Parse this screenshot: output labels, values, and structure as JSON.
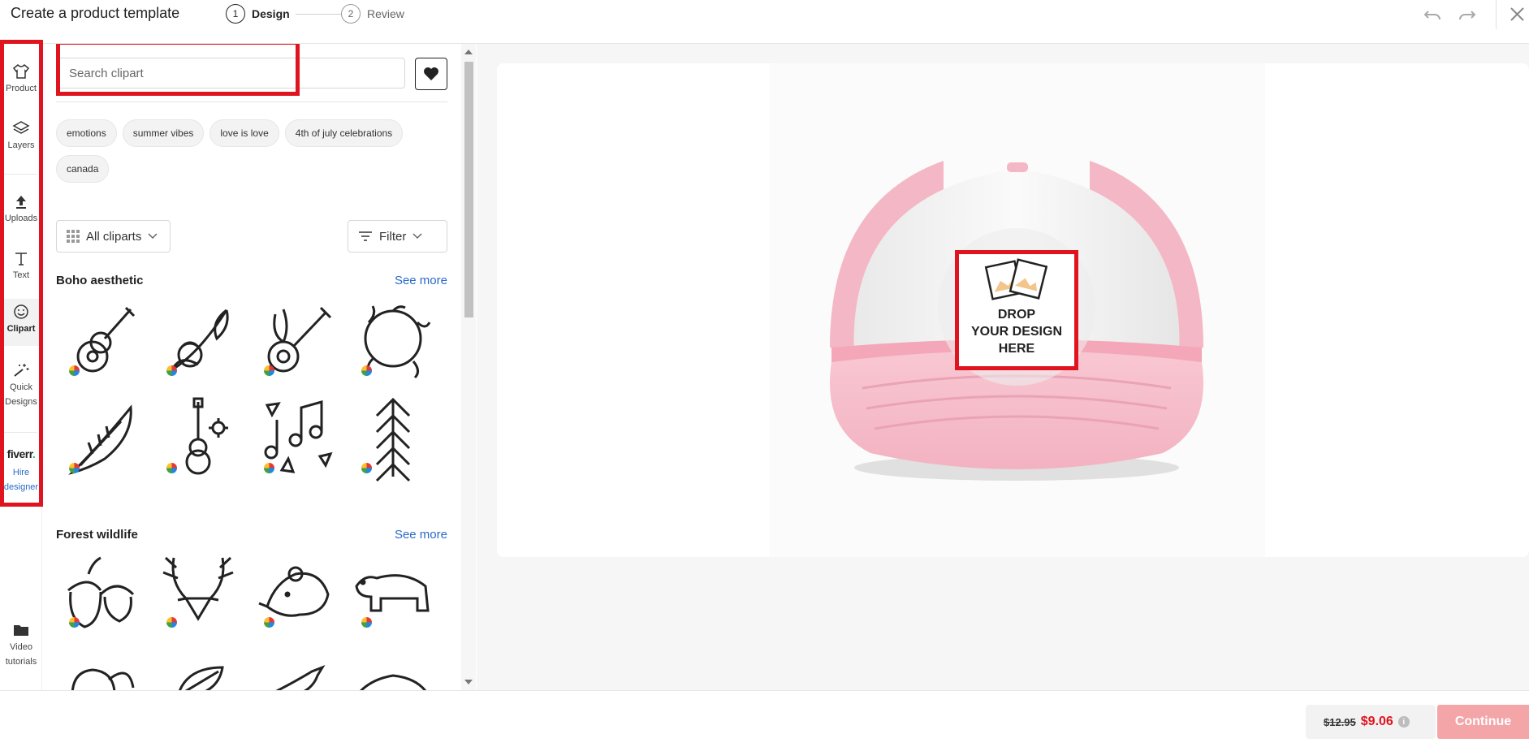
{
  "header": {
    "title": "Create a product template",
    "steps": [
      {
        "num": "1",
        "label": "Design",
        "active": true
      },
      {
        "num": "2",
        "label": "Review",
        "active": false
      }
    ],
    "icons": [
      "undo-icon",
      "redo-icon",
      "close-icon"
    ]
  },
  "rail": {
    "items": [
      {
        "label": "Product",
        "icon": "tshirt-icon"
      },
      {
        "label": "Layers",
        "icon": "layers-icon"
      },
      {
        "label": "Uploads",
        "icon": "upload-icon"
      },
      {
        "label": "Text",
        "icon": "text-icon"
      },
      {
        "label": "Clipart",
        "icon": "smiley-icon",
        "active": true
      },
      {
        "label": "Quick Designs",
        "icon": "magic-wand-icon"
      }
    ],
    "fiverr": {
      "logo": "fiverr",
      "dot": ".",
      "hire_label": "Hire designer"
    },
    "video": {
      "label": "Video tutorials",
      "icon": "folder-icon"
    }
  },
  "clipart": {
    "search_placeholder": "Search clipart",
    "chips": [
      "emotions",
      "summer vibes",
      "love is love",
      "4th of july celebrations",
      "canada"
    ],
    "all_cliparts_label": "All cliparts",
    "filter_label": "Filter",
    "sections": [
      {
        "title": "Boho aesthetic",
        "see_more": "See more",
        "items": [
          "guitar",
          "floral-branch",
          "banjo",
          "leaf-wreath",
          "feather",
          "guitar-flower",
          "music-notes",
          "arrow-chevrons"
        ]
      },
      {
        "title": "Forest wildlife",
        "see_more": "See more",
        "items": [
          "acorn",
          "antlers",
          "bear-head",
          "bear-walking",
          "squirrel",
          "leaf",
          "bird",
          "boar"
        ]
      }
    ]
  },
  "canvas": {
    "product": "pink trucker hat",
    "drop_text": [
      "DROP",
      "YOUR DESIGN",
      "HERE"
    ],
    "colors": {
      "hat_front": "#f5f5f5",
      "hat_bill": "#f7c3cf",
      "mesh": "#f4b7c5"
    }
  },
  "footer": {
    "old_price": "$12.95",
    "new_price": "$9.06",
    "info": "i",
    "continue_label": "Continue"
  }
}
